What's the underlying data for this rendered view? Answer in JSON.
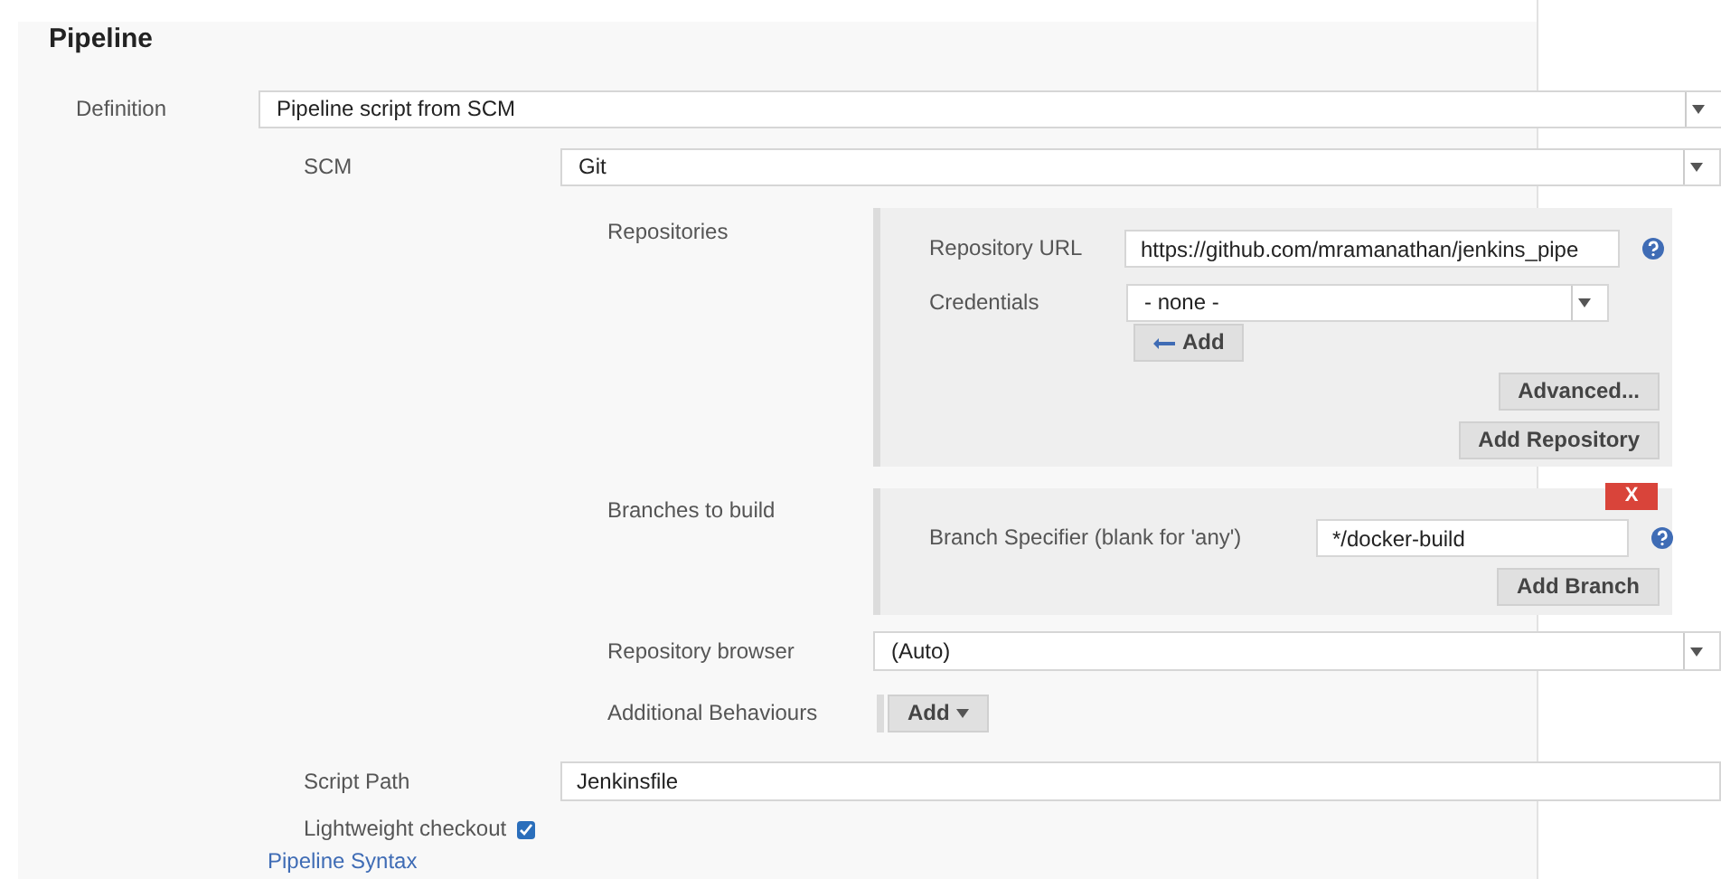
{
  "section": {
    "title": "Pipeline"
  },
  "definition": {
    "label": "Definition",
    "value": "Pipeline script from SCM"
  },
  "scm": {
    "label": "SCM",
    "value": "Git"
  },
  "repositories": {
    "label": "Repositories",
    "url_label": "Repository URL",
    "url": "https://github.com/mramanathan/jenkins_pipe",
    "credentials_label": "Credentials",
    "credentials": "- none -",
    "add_button": "Add",
    "advanced_button": "Advanced...",
    "add_repository_button": "Add Repository"
  },
  "branches": {
    "label": "Branches to build",
    "delete_button": "X",
    "specifier_label": "Branch Specifier (blank for 'any')",
    "specifier": "*/docker-build",
    "add_branch_button": "Add Branch"
  },
  "repository_browser": {
    "label": "Repository browser",
    "value": "(Auto)"
  },
  "additional_behaviours": {
    "label": "Additional Behaviours",
    "add_button": "Add"
  },
  "script_path": {
    "label": "Script Path",
    "value": "Jenkinsfile"
  },
  "lightweight_checkout": {
    "label": "Lightweight checkout",
    "checked": true
  },
  "pipeline_syntax_link": "Pipeline Syntax"
}
